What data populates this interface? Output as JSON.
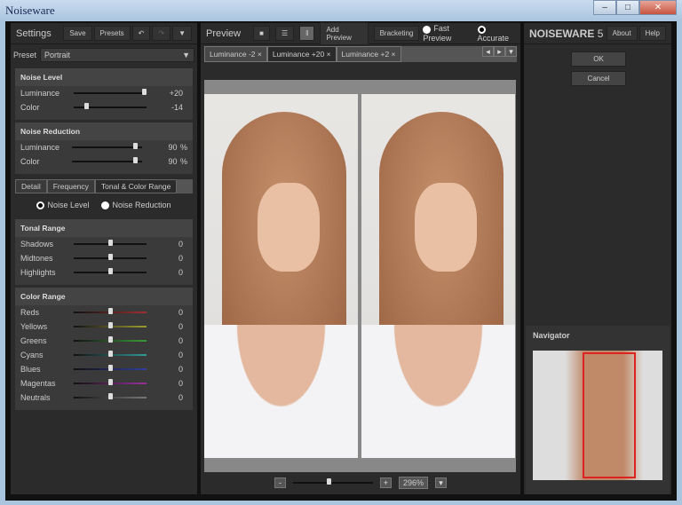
{
  "window": {
    "title": "Noiseware"
  },
  "left": {
    "title": "Settings",
    "save": "Save",
    "presets": "Presets",
    "preset_label": "Preset",
    "preset_value": "Portrait",
    "noise_level": {
      "title": "Noise Level",
      "rows": [
        {
          "label": "Luminance",
          "value": "+20",
          "pos": 1.0
        },
        {
          "label": "Color",
          "value": "-14",
          "pos": 0.15
        }
      ]
    },
    "noise_reduction": {
      "title": "Noise Reduction",
      "rows": [
        {
          "label": "Luminance",
          "value": "90",
          "unit": "%",
          "pos": 0.9
        },
        {
          "label": "Color",
          "value": "90",
          "unit": "%",
          "pos": 0.9
        }
      ]
    },
    "tabs": [
      "Detail",
      "Frequency",
      "Tonal & Color Range"
    ],
    "radios": [
      "Noise Level",
      "Noise Reduction"
    ],
    "tonal": {
      "title": "Tonal Range",
      "rows": [
        {
          "label": "Shadows",
          "value": "0"
        },
        {
          "label": "Midtones",
          "value": "0"
        },
        {
          "label": "Highlights",
          "value": "0"
        }
      ]
    },
    "color": {
      "title": "Color Range",
      "rows": [
        {
          "label": "Reds",
          "value": "0",
          "color": "#a03030"
        },
        {
          "label": "Yellows",
          "value": "0",
          "color": "#a09a30"
        },
        {
          "label": "Greens",
          "value": "0",
          "color": "#3a9a3a"
        },
        {
          "label": "Cyans",
          "value": "0",
          "color": "#309a9a"
        },
        {
          "label": "Blues",
          "value": "0",
          "color": "#3040a0"
        },
        {
          "label": "Magentas",
          "value": "0",
          "color": "#9a309a"
        },
        {
          "label": "Neutrals",
          "value": "0",
          "color": "#777777"
        }
      ]
    }
  },
  "center": {
    "title": "Preview",
    "add_preview": "Add Preview",
    "bracketing": "Bracketing",
    "fast_preview": "Fast Preview",
    "accurate": "Accurate",
    "tabs": [
      "Luminance -2",
      "Luminance +20",
      "Luminance +2"
    ],
    "zoom": "296%",
    "zoom_pos": 0.45
  },
  "right": {
    "brand": "NOISEWARE",
    "version": "5",
    "about": "About",
    "help": "Help",
    "ok": "OK",
    "cancel": "Cancel",
    "navigator": "Navigator"
  }
}
